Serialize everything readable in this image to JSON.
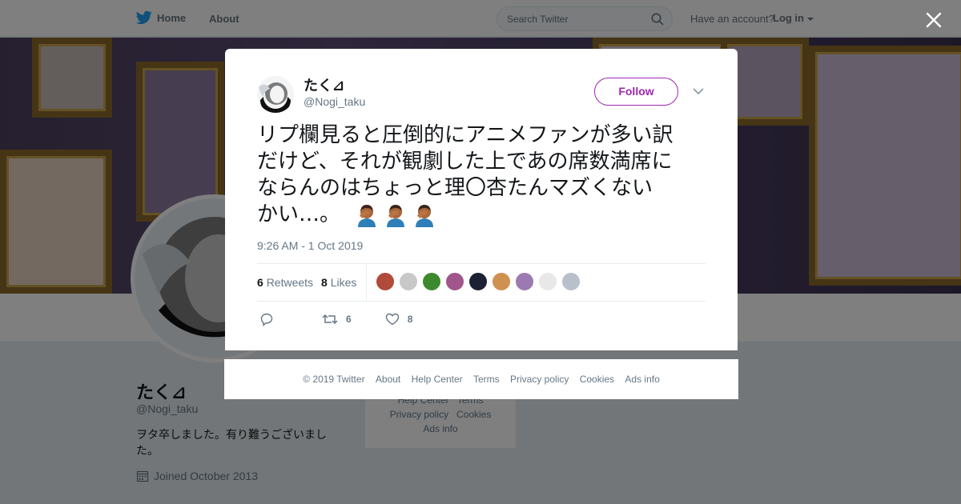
{
  "topbar": {
    "home_label": "Home",
    "about_label": "About",
    "search_placeholder": "Search Twitter",
    "have_account": "Have an account?",
    "login_label": "Log in"
  },
  "profile": {
    "name": "たく⊿",
    "handle": "@Nogi_taku",
    "bio": "ヲタ卒しました。有り難うございました。",
    "joined": "Joined October 2013"
  },
  "bg_footer": {
    "items": [
      "Help Center",
      "Terms",
      "Privacy policy",
      "Cookies",
      "Ads info"
    ]
  },
  "tweet": {
    "name": "たく⊿",
    "handle": "@Nogi_taku",
    "follow_label": "Follow",
    "text_lines": [
      "リプ欄見ると圧倒的にアニメファンが多い訳",
      "だけど、それが観劇した上であの席数満席に",
      "ならんのはちょっと理〇杏たんマズくない",
      "かい…。"
    ],
    "emoji": [
      "face-palm",
      "face-palm",
      "face-palm"
    ],
    "timestamp": "9:26 AM - 1 Oct 2019",
    "retweets_count": "6",
    "retweets_label": "Retweets",
    "likes_count": "8",
    "likes_label": "Likes",
    "action_retweets": "6",
    "action_likes": "8",
    "liker_colors": [
      "#b04a3a",
      "#c8c8c8",
      "#3b8a2e",
      "#a0568a",
      "#1c2233",
      "#d09050",
      "#9a7ab0",
      "#e8e8e8",
      "#b8c0cc"
    ]
  },
  "footer": {
    "links": [
      "© 2019 Twitter",
      "About",
      "Help Center",
      "Terms",
      "Privacy policy",
      "Cookies",
      "Ads info"
    ]
  },
  "colors": {
    "twitter_blue": "#1da1f2",
    "follow_purple": "#9c27b0",
    "muted": "#657786"
  }
}
